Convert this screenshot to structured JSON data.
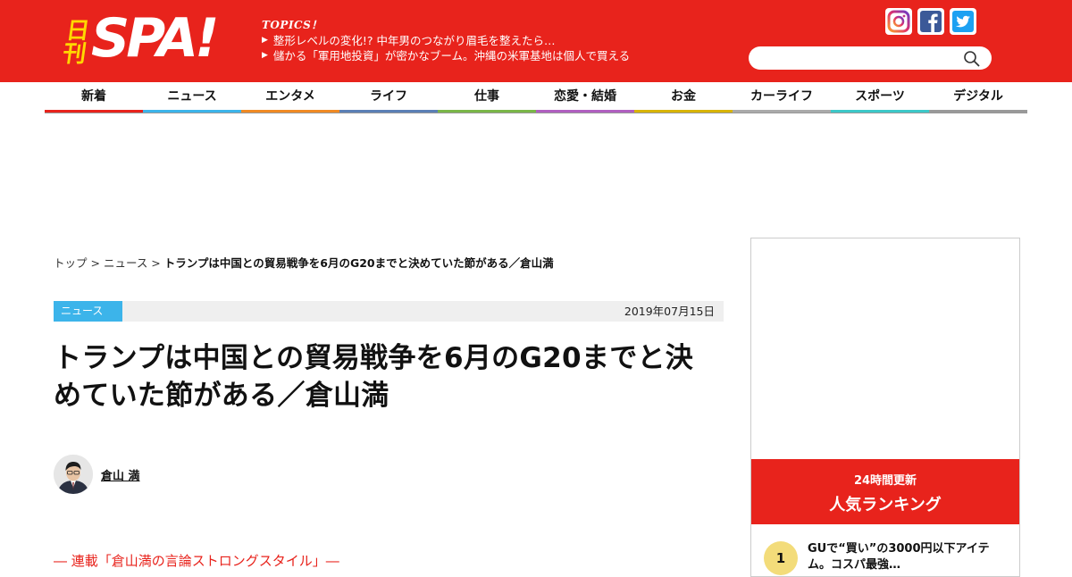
{
  "brand": {
    "logo_prefix": "日刊",
    "logo_text": "SPA!",
    "primary_color": "#e8231c",
    "logo_prefix_color": "#ffd800"
  },
  "topics": {
    "label": "TOPICS！",
    "items": [
      "整形レベルの変化!? 中年男のつながり眉毛を整えたら…",
      "儲かる「軍用地投資」が密かなブーム。沖縄の米軍基地は個人で買える"
    ]
  },
  "social": {
    "icons": [
      "instagram-icon",
      "facebook-icon",
      "twitter-icon"
    ]
  },
  "search": {
    "placeholder": "",
    "value": ""
  },
  "nav": {
    "items": [
      {
        "label": "新着",
        "color": "#e8231c"
      },
      {
        "label": "ニュース",
        "color": "#3cb4ea"
      },
      {
        "label": "エンタメ",
        "color": "#f08a24"
      },
      {
        "label": "ライフ",
        "color": "#5b7fb5"
      },
      {
        "label": "仕事",
        "color": "#7ab648"
      },
      {
        "label": "恋愛・結婚",
        "color": "#b05fc0"
      },
      {
        "label": "お金",
        "color": "#d8b400"
      },
      {
        "label": "カーライフ",
        "color": "#aaaaaa"
      },
      {
        "label": "スポーツ",
        "color": "#3cc8c8"
      },
      {
        "label": "デジタル",
        "color": "#999999"
      }
    ]
  },
  "breadcrumb": {
    "home": "トップ",
    "sep": " > ",
    "category": "ニュース",
    "current": "トランプは中国との貿易戦争を6月のG20までと決めていた節がある／倉山満"
  },
  "article": {
    "category": "ニュース",
    "category_color": "#3cb4ea",
    "date": "2019年07月15日",
    "title": "トランプは中国との貿易戦争を6月のG20までと決めていた節がある／倉山満",
    "author": "倉山 満",
    "series": "― 連載「倉山満の言論ストロングスタイル」―"
  },
  "sidebar": {
    "ranking_sub": "24時間更新",
    "ranking_title": "人気ランキング",
    "first_item": {
      "rank": "1",
      "text": "GUで“買い”の3000円以下アイテム。コスパ最強…"
    }
  }
}
